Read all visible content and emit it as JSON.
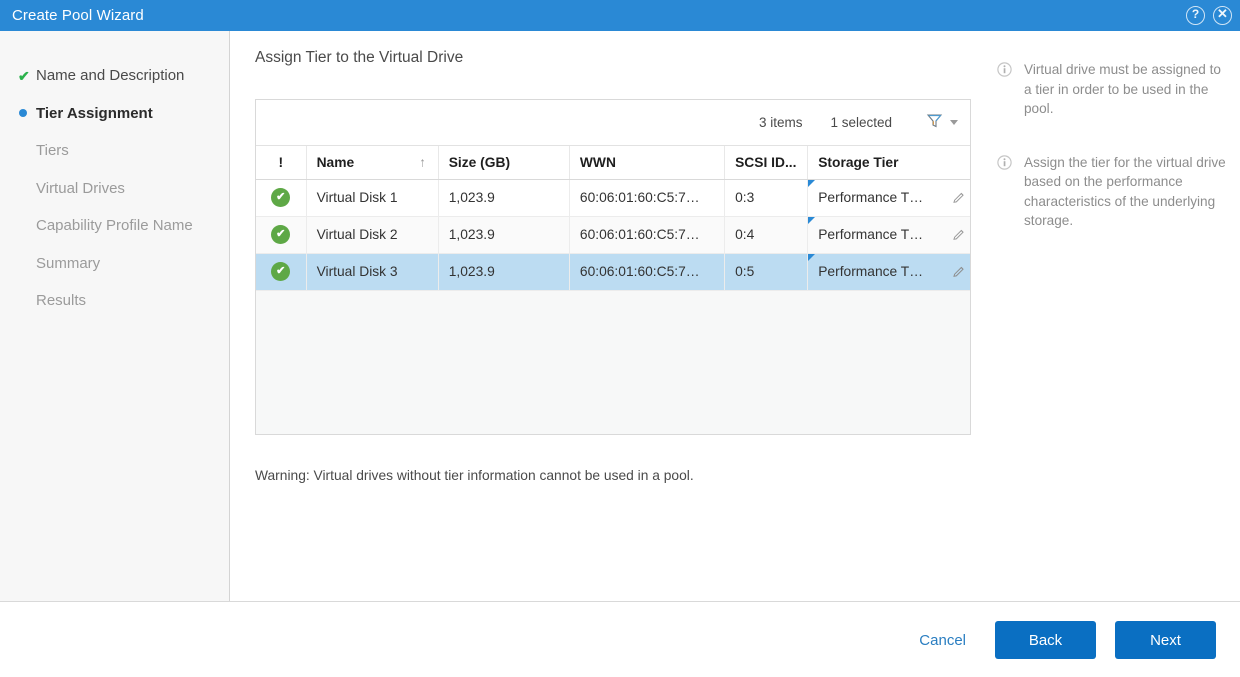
{
  "titlebar": {
    "title": "Create Pool Wizard",
    "help_icon": "help-icon",
    "help_glyph": "?",
    "close_icon": "close-icon",
    "close_glyph": "✕",
    "background": "#2a89d5"
  },
  "sidebar": {
    "items": [
      {
        "label": "Name and Description",
        "state": "done",
        "marker": "check-icon",
        "marker_glyph": "✔"
      },
      {
        "label": "Tier Assignment",
        "state": "active",
        "marker": "dot-icon",
        "marker_glyph": ""
      },
      {
        "label": "Tiers",
        "state": "upcoming",
        "marker": "none",
        "marker_glyph": ""
      },
      {
        "label": "Virtual Drives",
        "state": "upcoming",
        "marker": "none",
        "marker_glyph": ""
      },
      {
        "label": "Capability Profile Name",
        "state": "upcoming",
        "marker": "none",
        "marker_glyph": ""
      },
      {
        "label": "Summary",
        "state": "upcoming",
        "marker": "none",
        "marker_glyph": ""
      },
      {
        "label": "Results",
        "state": "upcoming",
        "marker": "none",
        "marker_glyph": ""
      }
    ],
    "done_color": "#2bb24c",
    "active_color": "#2a89d5"
  },
  "main": {
    "page_title": "Assign Tier to the Virtual Drive",
    "warning": "Warning: Virtual drives without tier information cannot be used in a pool."
  },
  "table": {
    "toolbar": {
      "item_count": "3 items",
      "selected_count": "1 selected",
      "filter_icon": "filter-funnel-icon"
    },
    "columns": [
      {
        "key": "flag",
        "label": "!",
        "width": 50,
        "sorted": false
      },
      {
        "key": "name",
        "label": "Name",
        "width": 132,
        "sorted": true,
        "sort_dir": "↑"
      },
      {
        "key": "size",
        "label": "Size (GB)",
        "width": 131,
        "sorted": false
      },
      {
        "key": "wwn",
        "label": "WWN",
        "width": 155,
        "sorted": false
      },
      {
        "key": "scsi",
        "label": "SCSI ID...",
        "width": 83,
        "sorted": false
      },
      {
        "key": "tier",
        "label": "Storage Tier",
        "width": 164,
        "sorted": false
      }
    ],
    "rows": [
      {
        "status": "ok",
        "status_glyph": "✔",
        "name": "Virtual Disk 1",
        "size": "1,023.9",
        "wwn": "60:06:01:60:C5:7…",
        "scsi": "0:3",
        "tier": "Performance T…",
        "selected": false
      },
      {
        "status": "ok",
        "status_glyph": "✔",
        "name": "Virtual Disk 2",
        "size": "1,023.9",
        "wwn": "60:06:01:60:C5:7…",
        "scsi": "0:4",
        "tier": "Performance T…",
        "selected": false
      },
      {
        "status": "ok",
        "status_glyph": "✔",
        "name": "Virtual Disk 3",
        "size": "1,023.9",
        "wwn": "60:06:01:60:C5:7…",
        "scsi": "0:5",
        "tier": "Performance T…",
        "selected": true
      }
    ],
    "selected_row_color": "#bcdcf2",
    "status_ok_color": "#5ea846",
    "editable_flag_color": "#2a89d5"
  },
  "info_panel": {
    "items": [
      {
        "icon": "info-icon",
        "text": "Virtual drive must be assigned to a tier in order to be used in the pool."
      },
      {
        "icon": "info-icon",
        "text": "Assign the tier for the virtual drive based on the performance characteristics of the underlying storage."
      }
    ]
  },
  "footer": {
    "cancel_label": "Cancel",
    "back_label": "Back",
    "next_label": "Next",
    "primary_color": "#0a6fc2",
    "link_color": "#2a7ec1"
  }
}
